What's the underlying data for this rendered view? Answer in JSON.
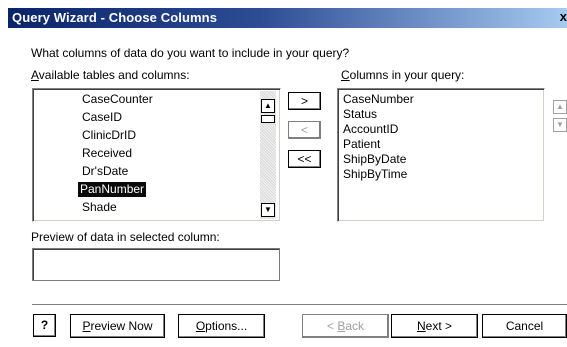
{
  "window": {
    "title": "Query Wizard - Choose Columns",
    "close_glyph": "x"
  },
  "prompt": "What columns of data do you want to include in your query?",
  "available": {
    "label_accel": "A",
    "label_rest": "vailable tables and columns:",
    "items": [
      "CaseCounter",
      "CaseID",
      "ClinicDrID",
      "Received",
      "Dr'sDate",
      "PanNumber",
      "Shade"
    ],
    "selected_item": "PanNumber"
  },
  "columns": {
    "label_accel": "C",
    "label_rest": "olumns in your query:",
    "items": [
      "CaseNumber",
      "Status",
      "AccountID",
      "Patient",
      "ShipByDate",
      "ShipByTime"
    ]
  },
  "transfer_buttons": {
    "add": ">",
    "remove": "<",
    "remove_all": "<<"
  },
  "preview": {
    "label": "Preview of data in selected column:",
    "value": ""
  },
  "footer": {
    "help_glyph": "?",
    "preview_now_accel": "P",
    "preview_now_rest": "review Now",
    "options_accel": "O",
    "options_rest": "ptions...",
    "back_prefix": "< ",
    "back_accel": "B",
    "back_rest": "ack",
    "next_accel": "N",
    "next_rest": "ext >",
    "cancel": "Cancel"
  },
  "icons": {
    "scroll_up": "up-triangle",
    "scroll_down": "down-triangle"
  }
}
